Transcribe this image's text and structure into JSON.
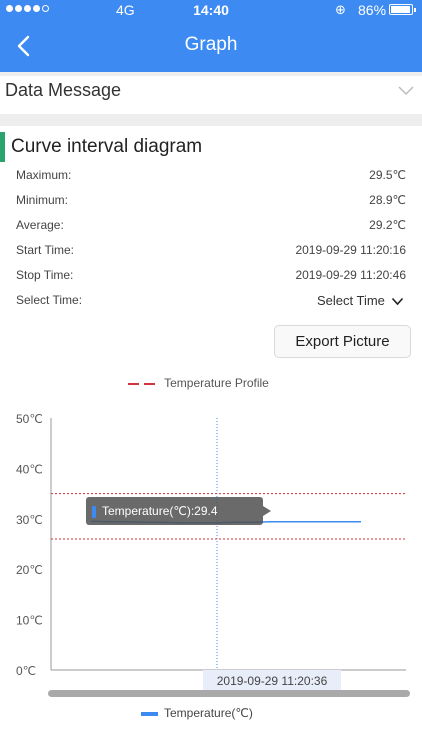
{
  "status_bar": {
    "network": "4G",
    "time": "14:40",
    "battery_percent": "86%",
    "battery_level": 0.86
  },
  "nav": {
    "title": "Graph"
  },
  "data_message": {
    "label": "Data Message"
  },
  "curve": {
    "title": "Curve interval diagram",
    "rows": [
      {
        "key": "Maximum:",
        "value": "29.5℃"
      },
      {
        "key": "Minimum:",
        "value": "28.9℃"
      },
      {
        "key": "Average:",
        "value": "29.2℃"
      },
      {
        "key": "Start Time:",
        "value": "2019-09-29 11:20:16"
      },
      {
        "key": "Stop Time:",
        "value": "2019-09-29 11:20:46"
      },
      {
        "key": "Select Time:",
        "value": ""
      }
    ],
    "select_time_label": "Select Time",
    "export_button": "Export Picture"
  },
  "colors": {
    "accent": "#3d8bf2",
    "profile_line": "#d0333c",
    "curve_bar": "#2ba36f"
  },
  "chart_data": {
    "type": "line",
    "legend_top": "Temperature Profile",
    "legend_bottom": "Temperature(℃)",
    "y_tick_labels": [
      "50℃",
      "40℃",
      "30℃",
      "20℃",
      "10℃",
      "0℃"
    ],
    "ylim": [
      0,
      50
    ],
    "profile_lines": [
      35,
      26
    ],
    "series": [
      {
        "name": "Temperature(℃)",
        "values": [
          29.5,
          29.4,
          29.4,
          29.3,
          29.3,
          29.2,
          29.2,
          29.2,
          29.3,
          29.3,
          29.4,
          29.4,
          29.4,
          29.4,
          29.4,
          29.4
        ]
      }
    ],
    "tooltip": "Temperature(℃):29.4",
    "cursor_label": "2019-09-29 11:20:36",
    "cursor_index": 7
  }
}
